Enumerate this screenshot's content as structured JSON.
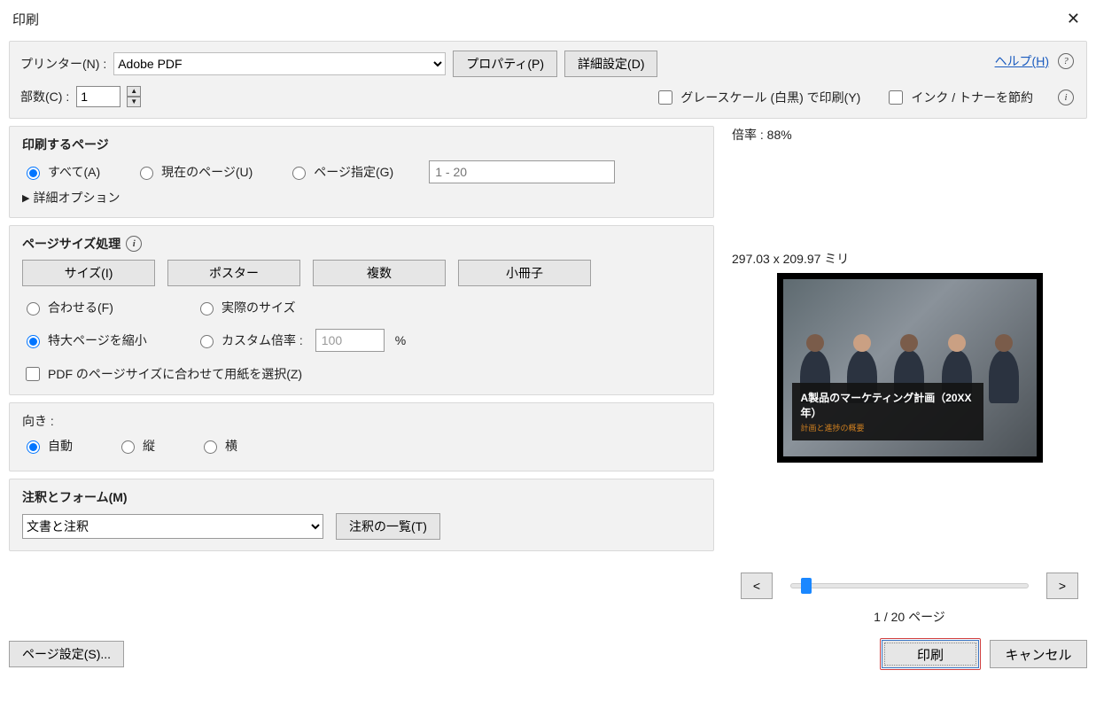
{
  "window": {
    "title": "印刷"
  },
  "help": {
    "label": "ヘルプ(H)"
  },
  "top": {
    "printer_label": "プリンター(N) :",
    "printer_selected": "Adobe PDF",
    "properties_btn": "プロパティ(P)",
    "advanced_btn": "詳細設定(D)",
    "copies_label": "部数(C) :",
    "copies_value": "1",
    "grayscale_label": "グレースケール (白黒) で印刷(Y)",
    "save_ink_label": "インク / トナーを節約"
  },
  "pages": {
    "heading": "印刷するページ",
    "all_label": "すべて(A)",
    "current_label": "現在のページ(U)",
    "range_label": "ページ指定(G)",
    "range_placeholder": "1 - 20",
    "advanced_toggle": "詳細オプション"
  },
  "sizing": {
    "heading": "ページサイズ処理",
    "btn_size": "サイズ(I)",
    "btn_poster": "ポスター",
    "btn_multiple": "複数",
    "btn_booklet": "小冊子",
    "fit_label": "合わせる(F)",
    "actual_label": "実際のサイズ",
    "shrink_label": "特大ページを縮小",
    "custom_label": "カスタム倍率 :",
    "custom_value": "100",
    "custom_pct": "%",
    "match_paper_label": "PDF のページサイズに合わせて用紙を選択(Z)"
  },
  "orient": {
    "heading": "向き :",
    "auto": "自動",
    "portrait": "縦",
    "landscape": "横"
  },
  "comments": {
    "heading": "注釈とフォーム(M)",
    "selected": "文書と注釈",
    "summary_btn": "注釈の一覧(T)"
  },
  "preview": {
    "scale_label": "倍率 :  88%",
    "dimensions": "297.03 x 209.97 ミリ",
    "caption_title": "A製品のマーケティング計画（20XX年）",
    "caption_sub": "計画と進捗の概要",
    "counter": "1 / 20 ページ",
    "prev": "<",
    "next": ">"
  },
  "footer": {
    "page_setup": "ページ設定(S)...",
    "print": "印刷",
    "cancel": "キャンセル"
  }
}
